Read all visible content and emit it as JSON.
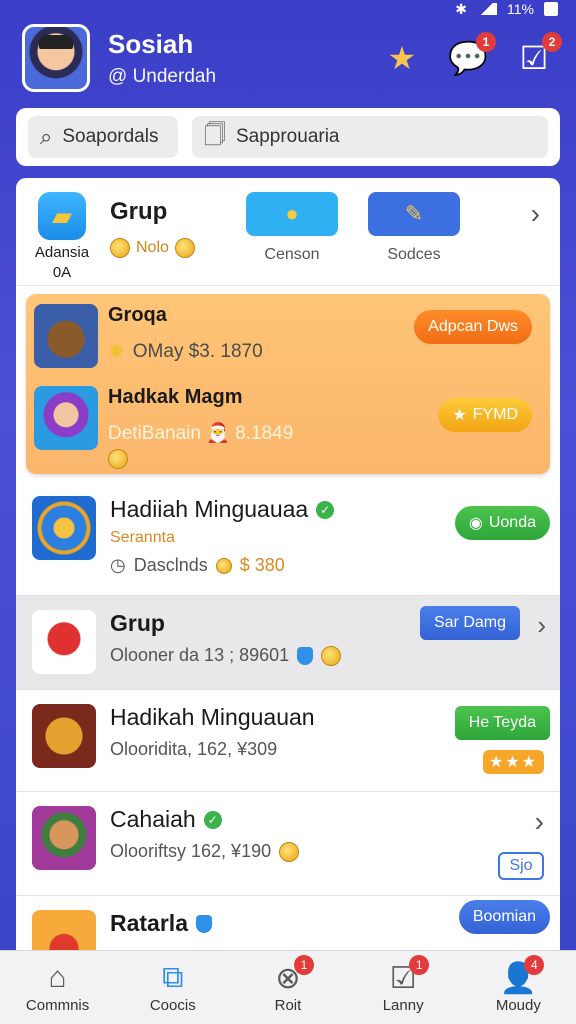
{
  "status": {
    "battery": "11%"
  },
  "user": {
    "name": "Sosiah",
    "handle": "@ Underdah"
  },
  "header_badges": {
    "chat": "1",
    "tasks": "2"
  },
  "search": {
    "left_placeholder": "Soapordals",
    "right_placeholder": "Sapprouaria"
  },
  "group": {
    "app_label": "Adansia",
    "app_sublabel": "0A",
    "title": "Grup",
    "coin_text": "Nolo",
    "buttons": [
      {
        "label": "Censon"
      },
      {
        "label": "Sodces"
      }
    ]
  },
  "featured": [
    {
      "title": "Groqa",
      "subtitle": "OMay $3. 1870",
      "action": "Adpcan Dws"
    },
    {
      "title": "Hadkak Magm",
      "subtitle": "DetiBanain 🎅 8.1849",
      "action": "FYMD"
    }
  ],
  "list": [
    {
      "title": "Hadiiah Minguauaa",
      "tag": "Serannta",
      "subtitle": "Dasclnds",
      "value": "$ 380",
      "action": "Uonda"
    },
    {
      "title": "Grup",
      "subtitle": "Olooner da 13 ; 89601",
      "action": "Sar Damg"
    },
    {
      "title": "Hadikah Minguauan",
      "subtitle": "Olooridita, 162, ¥309",
      "action": "He Teyda"
    },
    {
      "title": "Cahaiah",
      "subtitle": "Olooriftsy 162, ¥190",
      "action": "Sjo"
    },
    {
      "title": "Ratarla",
      "action": "Boomian"
    }
  ],
  "tabs": [
    {
      "label": "Commnis",
      "icon": "home-icon"
    },
    {
      "label": "Coocis",
      "icon": "link-icon"
    },
    {
      "label": "Roit",
      "icon": "close-circle-icon",
      "badge": "1"
    },
    {
      "label": "Lanny",
      "icon": "check-box-icon",
      "badge": "1"
    },
    {
      "label": "Moudy",
      "icon": "person-icon",
      "badge": "4"
    }
  ]
}
